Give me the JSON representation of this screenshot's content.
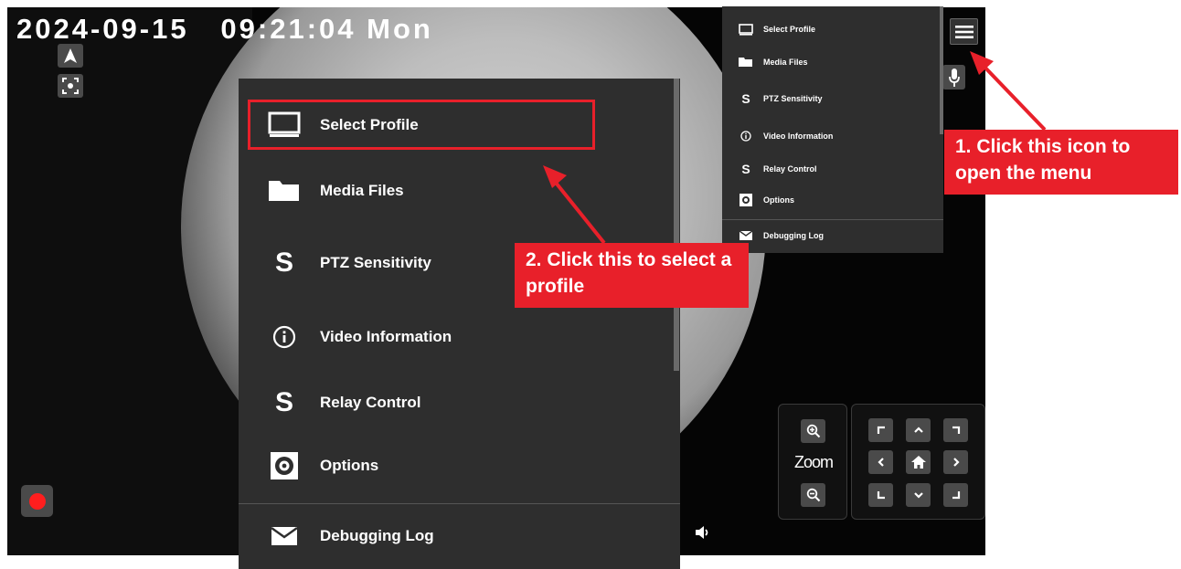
{
  "overlay": {
    "datetime": "2024-09-15   09:21:04 Mon"
  },
  "menu_items": [
    {
      "label": "Select Profile",
      "icon": "monitor-icon"
    },
    {
      "label": "Media Files",
      "icon": "folder-icon"
    },
    {
      "label": "PTZ Sensitivity",
      "icon": "s-letter-icon"
    },
    {
      "label": "Video Information",
      "icon": "info-icon"
    },
    {
      "label": "Relay Control",
      "icon": "s-letter-icon"
    },
    {
      "label": "Options",
      "icon": "gear-icon"
    },
    {
      "label": "Debugging Log",
      "icon": "envelope-icon"
    }
  ],
  "annotations": {
    "step1": "1. Click this icon to open the menu",
    "step2": "2. Click this to select a profile"
  },
  "zoom": {
    "label": "Zoom"
  },
  "colors": {
    "accent": "#e8202a",
    "menu_bg": "#2e2e2e",
    "video_bg": "#050505",
    "record": "#ff1e1e"
  }
}
